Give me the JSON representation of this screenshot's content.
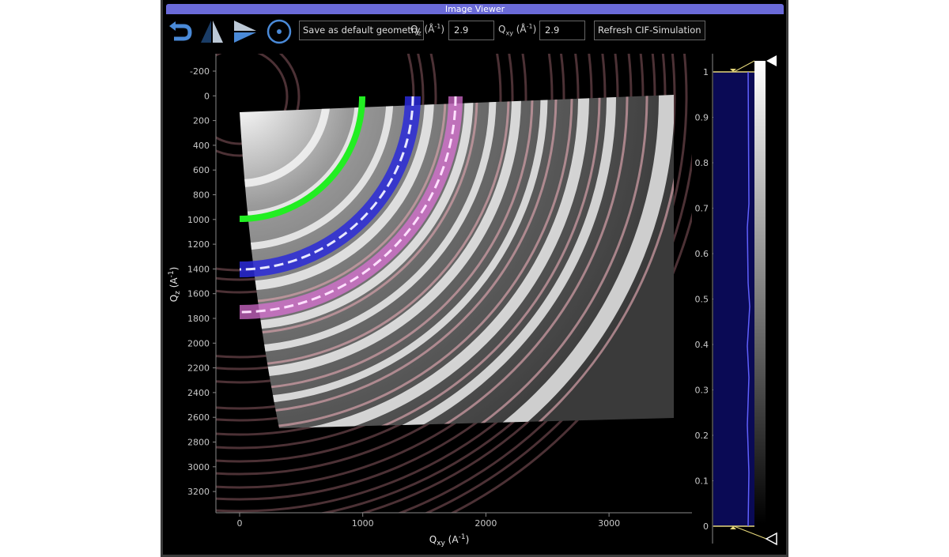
{
  "window": {
    "title": "Image Viewer"
  },
  "toolbar": {
    "rotate_icon": "undo-arrow-icon",
    "flip_vertical_icon": "flip-vertical-icon",
    "flip_horizontal_icon": "flip-horizontal-icon",
    "center_icon": "target-icon",
    "save_geometry_label": "Save as default geometry",
    "qz_label": "Q",
    "qz_sub": "z",
    "qz_unit_pre": " (Å",
    "qz_unit_sup": "-1",
    "qz_unit_post": ")",
    "qz_value": "2.9",
    "qxy_label": "Q",
    "qxy_sub": "xy",
    "qxy_unit_pre": " (Å",
    "qxy_unit_sup": "-1",
    "qxy_unit_post": ")",
    "qxy_value": "2.9",
    "refresh_label": "Refresh CIF-Simulation"
  },
  "image_plot": {
    "x_axis": {
      "label_main": "Q",
      "label_sub": "xy",
      "label_unit": " (A",
      "label_sup": "-1",
      "label_close": ")",
      "ticks": [
        "0",
        "1000",
        "2000",
        "3000"
      ]
    },
    "y_axis": {
      "label_main": "Q",
      "label_sub": "z",
      "label_unit": " (A",
      "label_sup": "-1",
      "label_close": ")",
      "ticks": [
        "-200",
        "0",
        "200",
        "400",
        "600",
        "800",
        "1000",
        "1200",
        "1400",
        "1600",
        "1800",
        "2000",
        "2200",
        "2400",
        "2600",
        "2800",
        "3000",
        "3200"
      ]
    },
    "highlight_colors": {
      "green": "#22ee22",
      "blue": "#2a2ad8",
      "pink": "#e070d8",
      "ring": "#c89aa0"
    }
  },
  "histogram": {
    "ticks": [
      "1",
      "0.9",
      "0.8",
      "0.7",
      "0.6",
      "0.5",
      "0.4",
      "0.3",
      "0.2",
      "0.1",
      "0"
    ],
    "fill_color": "#0a0a55",
    "line_color": "#6060ff",
    "handle_color": "#e6d87a"
  }
}
